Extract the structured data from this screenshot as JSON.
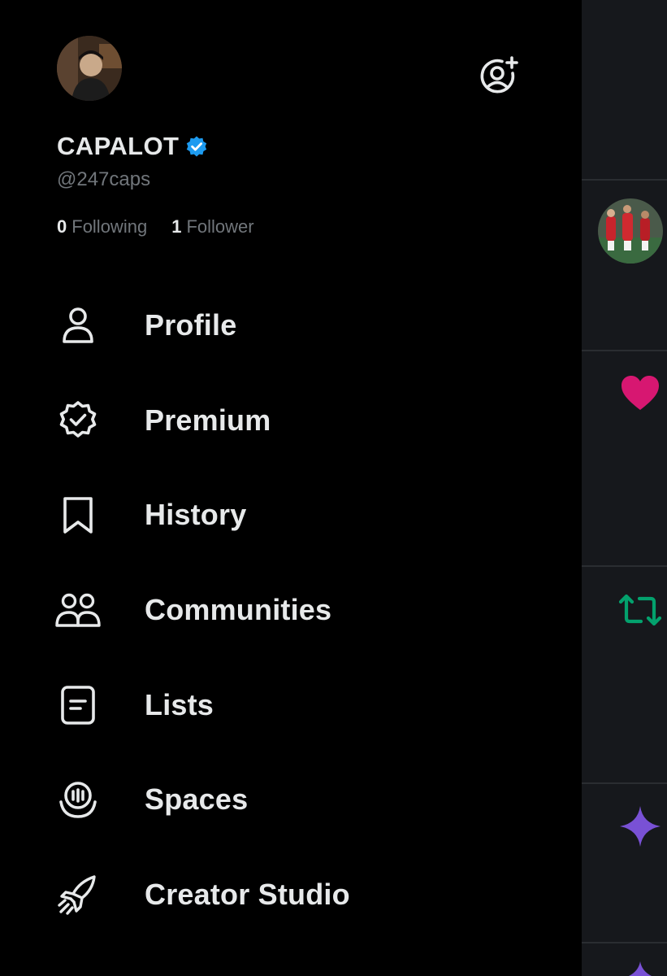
{
  "header": {
    "display_name": "CAPALOT",
    "handle": "@247caps"
  },
  "stats": {
    "following_count": "0",
    "following_label": "Following",
    "followers_count": "1",
    "followers_label": "Follower"
  },
  "menu": [
    {
      "label": "Profile",
      "icon": "person-icon"
    },
    {
      "label": "Premium",
      "icon": "verified-badge-icon"
    },
    {
      "label": "History",
      "icon": "bookmark-icon"
    },
    {
      "label": "Communities",
      "icon": "people-icon"
    },
    {
      "label": "Lists",
      "icon": "list-icon"
    },
    {
      "label": "Spaces",
      "icon": "microphone-icon"
    },
    {
      "label": "Creator Studio",
      "icon": "rocket-icon"
    }
  ],
  "colors": {
    "background": "#000000",
    "text_primary": "#e7e9ea",
    "text_secondary": "#71767b",
    "verified_blue": "#1d9bf0",
    "like_pink": "#f91880",
    "retweet_green": "#00ba7c",
    "grok_purple": "#8b5cf6",
    "timeline_bg": "#16181c"
  }
}
